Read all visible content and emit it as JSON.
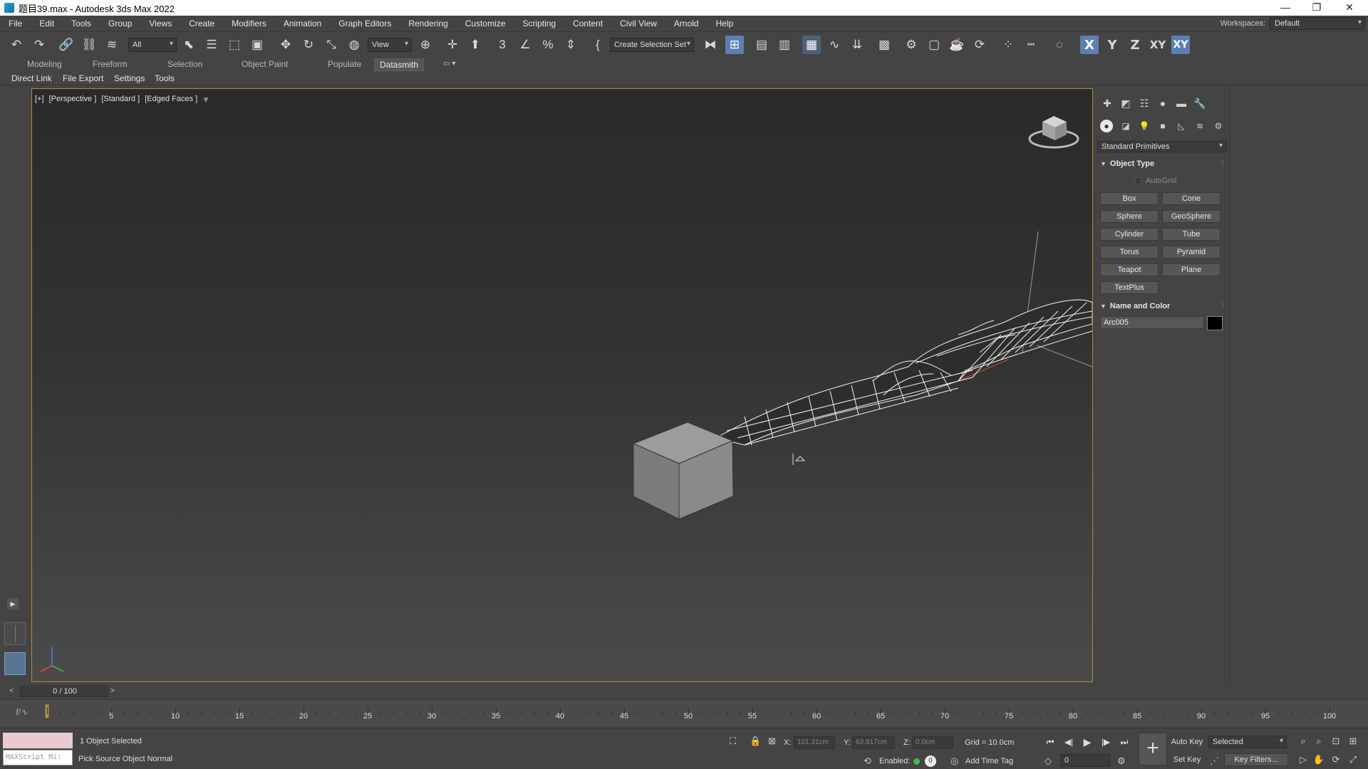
{
  "window": {
    "title": "题目39.max - Autodesk 3ds Max 2022",
    "minimize": "—",
    "restore": "❐",
    "close": "✕"
  },
  "menu": [
    "File",
    "Edit",
    "Tools",
    "Group",
    "Views",
    "Create",
    "Modifiers",
    "Animation",
    "Graph Editors",
    "Rendering",
    "Customize",
    "Scripting",
    "Content",
    "Civil View",
    "Arnold",
    "Help"
  ],
  "workspaces": {
    "label": "Workspaces:",
    "value": "Default"
  },
  "toolbar": {
    "selection_filter": "All",
    "ref_coord": "View",
    "named_selection": "Create Selection Set",
    "axis_x": "X",
    "axis_y": "Y",
    "axis_z": "Z",
    "axis_xy": "XY",
    "axis_xy2": "XY"
  },
  "ribbon_tabs": [
    "Modeling",
    "Freeform",
    "Selection",
    "Object Paint",
    "Populate",
    "Datasmith"
  ],
  "ribbon_active": "Datasmith",
  "datasmith_menu": [
    "Direct Link",
    "File Export",
    "Settings",
    "Tools"
  ],
  "viewport": {
    "labels": [
      "[+]",
      "[Perspective ]",
      "[Standard ]",
      "[Edged Faces ]"
    ]
  },
  "command_panel": {
    "category": "Standard Primitives",
    "object_type_title": "Object Type",
    "autogrid": "AutoGrid",
    "primitives": [
      "Box",
      "Cone",
      "Sphere",
      "GeoSphere",
      "Cylinder",
      "Tube",
      "Torus",
      "Pyramid",
      "Teapot",
      "Plane",
      "TextPlus"
    ],
    "name_color_title": "Name and Color",
    "object_name": "Arc005",
    "object_color": "#000000"
  },
  "time_slider": {
    "label": "0 / 100"
  },
  "trackbar": {
    "ticks": [
      "5",
      "10",
      "15",
      "20",
      "25",
      "30",
      "35",
      "40",
      "45",
      "50",
      "55",
      "60",
      "65",
      "70",
      "75",
      "80",
      "85",
      "90",
      "95",
      "100"
    ]
  },
  "status": {
    "maxscript": "MAXScript Mi:",
    "selection": "1 Object Selected",
    "prompt": "Pick Source Object Normal",
    "x_label": "X:",
    "x_value": "101.31cm",
    "y_label": "Y:",
    "y_value": "63.917cm",
    "z_label": "Z:",
    "z_value": "0.0cm",
    "grid": "Grid = 10.0cm",
    "enabled": "Enabled:",
    "enabled_value": "0",
    "add_time_tag": "Add Time Tag",
    "frame": "0",
    "auto_key": "Auto Key",
    "set_key": "Set Key",
    "key_mode": "Selected",
    "key_filters": "Key Filters..."
  },
  "colors": {
    "viewport_border": "#a58f3c",
    "active_tool": "#5d7fb3",
    "enabled_dot": "#3dbb4d"
  }
}
